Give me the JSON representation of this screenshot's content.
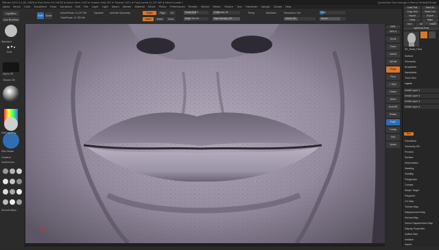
{
  "titlebar": {
    "text": "ZBrush 2021.6.4  [ZL-NAS]  ● Free Mem 29.744GB ● Active Mem 1343 ● Scratch Disk 261 ● Timer● 0.021 ● PolyCount● 11.237 MP ● MeshCount● 1",
    "right": "QuickSave   See-through 0   Menus   DefaultZScript"
  },
  "menu": [
    "Alpha",
    "Brush",
    "Color",
    "Document",
    "Draw",
    "Dynamics",
    "Edit",
    "File",
    "Layer",
    "Light",
    "Macro",
    "Marker",
    "Material",
    "Movie",
    "Picker",
    "Preferences",
    "Render",
    "Stencil",
    "Stroke",
    "Texture",
    "Tool",
    "Transform",
    "Zplugin",
    "Zscript",
    "Help"
  ],
  "top": {
    "lightbox": "LightBox",
    "liveboolean": "Live Boolean",
    "edit": "Edit",
    "draw": "Draw",
    "move": "Move",
    "scale": "Scale",
    "rotate": "Rotate",
    "active_points": "ActivePoints: 11.237 Mil",
    "total_points": "TotalPoints: 11.790 Mil",
    "mrgb": "Mrgb",
    "rgb": "Rgb",
    "m": "M",
    "zadd": "Zadd",
    "zsub": "Zsub",
    "zcut": "Zcut",
    "focal_shift": "Focal Shift 0",
    "draw_size": "Draw Size 64",
    "dynamic": "Dynamic",
    "z_intensity": "Z Intensity 25",
    "rgb_intensity": "Rgb Intensity 100",
    "backface": "Backface",
    "sym": "Activate Symmetry",
    "persp": "Persp",
    "floor": "Floor",
    "local": "Local",
    "lsym": "L.Sym",
    "frame": "Frame",
    "move2": "Move",
    "zoom3d": "Zoom3D",
    "rotate2": "Rotate",
    "polyf": "PolyF",
    "transp": "Transp",
    "dynamic2": "Dynamic",
    "solo": "Solo",
    "xpose": "Xpose",
    "resolution": "Resolution 128",
    "gizmo": "Gizmo 3D"
  },
  "left": {
    "brush_label": "Standard",
    "stroke_label": "Dots",
    "alpha_label": "Alpha Off",
    "texture_label": "Texture Off",
    "material_label": "MatCap Gray",
    "gradient": "Gradient",
    "switch": "SwitchColor",
    "alternate": "Alternate",
    "skin": "Skin Shade",
    "smooth": "Smooth",
    "smooth_label": "SmoothValley",
    "mat_names": [
      "BasicMaterial",
      "Chalk",
      "SkinShade4",
      "MatCap Gray",
      "BasicMat2",
      "Toy Plastic"
    ]
  },
  "right_shelf": [
    "BPR",
    "SPix 3",
    "Scroll",
    "Zoom",
    "Actual",
    "AAHalf",
    "Persp",
    "Floor",
    "L.Sym",
    "Frame",
    "Move",
    "Zoom3D",
    "Rotate",
    "PolyF",
    "Transp",
    "Solo",
    "Xpose"
  ],
  "tray": {
    "top_buttons": [
      "Load Tool",
      "Save As",
      "Copy Tool",
      "Paste Tool",
      "Import",
      "Export",
      "Clone",
      "Make PolyMesh3D",
      "GoZ",
      "All",
      "Visible",
      "R"
    ],
    "tool_name": "Lightbox▸Tools",
    "head_label": "SK_Head_Final",
    "sections": [
      "Subtool",
      "Geometry",
      "ArrayMesh",
      "NanoMesh",
      "Thick Skin",
      "Layers"
    ],
    "layers": [
      "Detail Layer 1",
      "Detail Layer 2",
      "Detail Layer 3",
      "Detail Layer 4"
    ],
    "record": "Rec",
    "fibermesh": "FiberMesh",
    "geomhd": "Geometry HD",
    "preview": "Preview",
    "items": [
      "FiberMesh",
      "Geometry HD",
      "Preview",
      "Surface",
      "Deformation",
      "Masking",
      "Visibility",
      "Polygroups",
      "Contact",
      "Morph Target",
      "Polypaint",
      "UV Map",
      "Texture Map",
      "Displacement Map",
      "Normal Map",
      "Vector Displacement Map",
      "Display Properties",
      "Unified Skin",
      "Initialize",
      "Import",
      "Export"
    ]
  }
}
